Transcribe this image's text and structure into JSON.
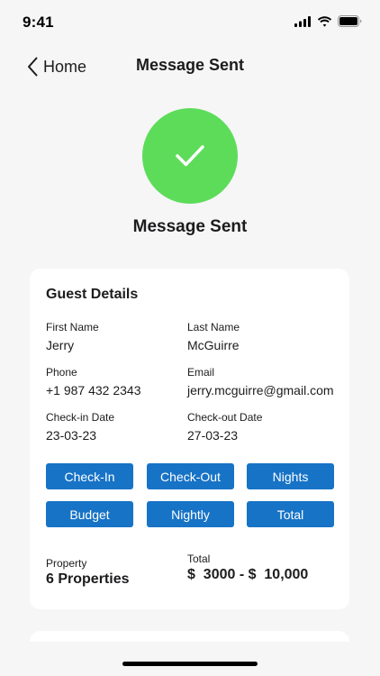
{
  "status_bar": {
    "time": "9:41"
  },
  "nav": {
    "back_label": "Home",
    "title": "Message Sent"
  },
  "success": {
    "title": "Message Sent",
    "color": "#5ddc5a"
  },
  "guest_details": {
    "title": "Guest Details",
    "first_name": {
      "label": "First Name",
      "value": "Jerry"
    },
    "last_name": {
      "label": "Last Name",
      "value": "McGuirre"
    },
    "phone": {
      "label": "Phone",
      "value": "+1 987 432 2343"
    },
    "email": {
      "label": "Email",
      "value": "jerry.mcguirre@gmail.com"
    },
    "check_in": {
      "label": "Check-in Date",
      "value": "23-03-23"
    },
    "check_out": {
      "label": "Check-out Date",
      "value": "27-03-23"
    },
    "chips": [
      "Check-In",
      "Check-Out",
      "Nights",
      "Budget",
      "Nightly",
      "Total"
    ],
    "chip_color": "#1773c6",
    "property": {
      "label": "Property",
      "value": "6 Properties"
    },
    "total": {
      "label": "Total",
      "value": "$  3000 - $  10,000"
    }
  }
}
